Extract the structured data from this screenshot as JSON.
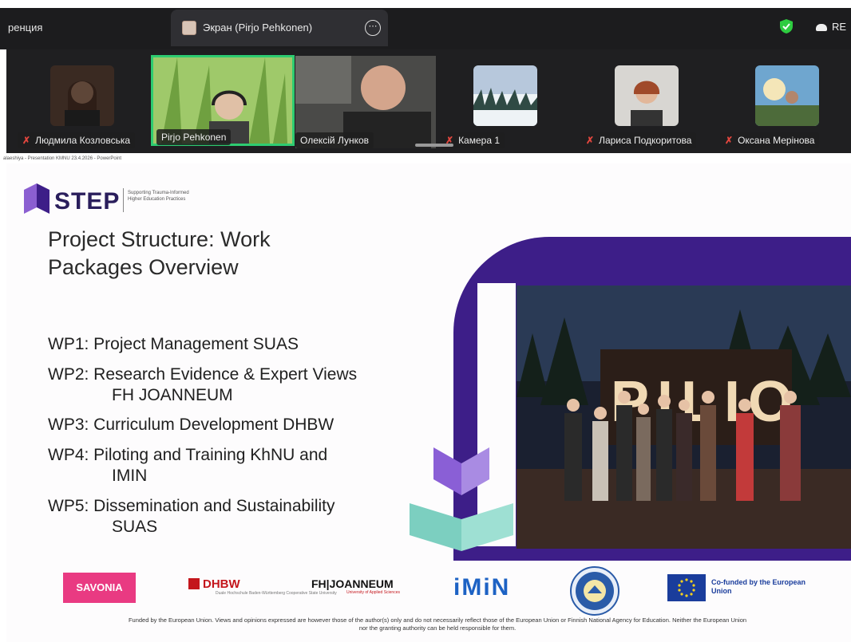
{
  "meeting": {
    "left_tab_label": "ренция",
    "active_tab_label": "Экран (Pirjo Pehkonen)",
    "more_label": "⋯",
    "rec_label": "RE"
  },
  "participants": [
    {
      "name": "Людмила Козловська",
      "muted": true
    },
    {
      "name": "Pirjo Pehkonen",
      "muted": false,
      "active": true
    },
    {
      "name": "Олексій Лунков",
      "muted": false
    },
    {
      "name": "Камера 1",
      "muted": true
    },
    {
      "name": "Лариса Подкоритова",
      "muted": true
    },
    {
      "name": "Оксана Мерінова",
      "muted": true
    }
  ],
  "powerpoint_title": "alaeshiya - Presentation KMNU 23.4.2026 - PowerPoint",
  "slide": {
    "logo": {
      "name": "STEP",
      "tagline": "Supporting Trauma-Informed Higher Education Practices"
    },
    "title": "Project Structure: Work Packages Overview",
    "work_packages": [
      {
        "line1": "WP1: Project Management SUAS",
        "line2": ""
      },
      {
        "line1": "WP2: Research Evidence & Expert Views",
        "line2": "FH JOANNEUM"
      },
      {
        "line1": "WP3: Curriculum Development DHBW",
        "line2": ""
      },
      {
        "line1": "WP4: Piloting and Training KhNU and",
        "line2": "IMIN"
      },
      {
        "line1": "WP5: Dissemination and Sustainability",
        "line2": "SUAS"
      }
    ],
    "photo_sign_text": "PILIO",
    "partner_logos": {
      "savonia": "SAVONIA",
      "dhbw": "DHBW",
      "dhbw_sub": "Duale Hochschule Baden-Württemberg Cooperative State University",
      "fhj": "FH|JOANNEUM",
      "fhj_sub": "University of Applied Sciences",
      "imin": "iMiN",
      "eu": "Co-funded by the European Union"
    },
    "disclaimer": "Funded by the European Union. Views and opinions expressed are however those of the author(s) only and do not necessarily reflect those of the European Union or Finnish National Agency for Education. Neither the European Union nor the granting authority can be held responsible for them."
  },
  "colors": {
    "accent_purple": "#3d1e88",
    "active_green": "#2ecc71",
    "savonia_pink": "#e93a82",
    "eu_blue": "#1a3d9c"
  }
}
